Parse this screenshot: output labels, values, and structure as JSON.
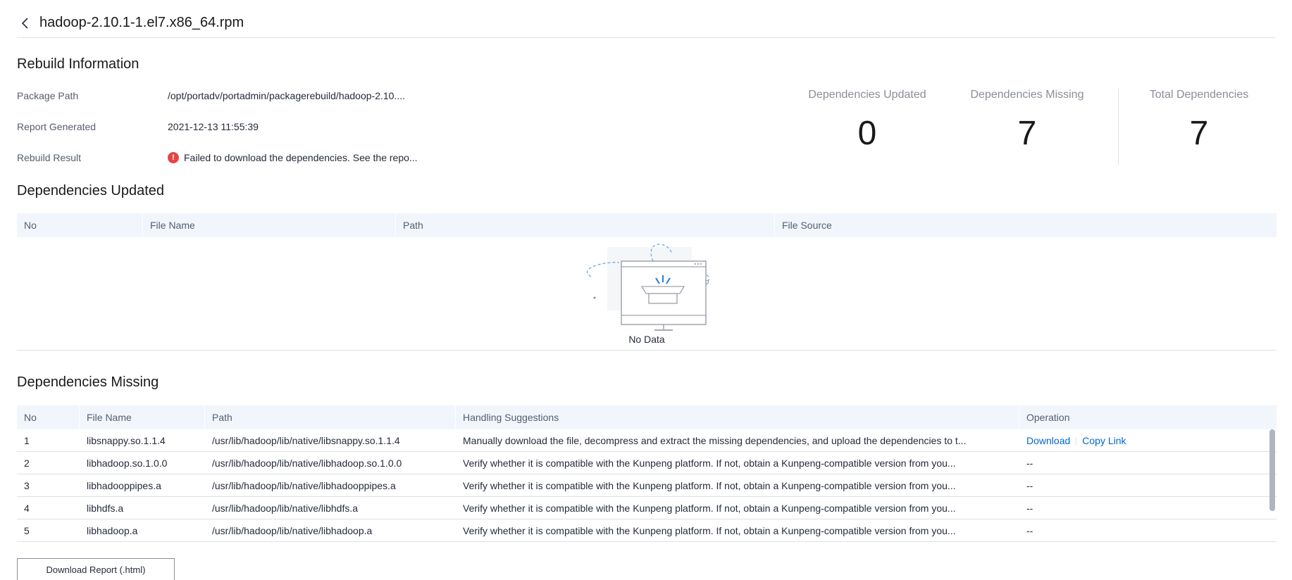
{
  "header": {
    "title": "hadoop-2.10.1-1.el7.x86_64.rpm"
  },
  "rebuild_info": {
    "title": "Rebuild Information",
    "rows": [
      {
        "label": "Package Path",
        "value": "/opt/portadv/portadmin/packagerebuild/hadoop-2.10...."
      },
      {
        "label": "Report Generated",
        "value": "2021-12-13 11:55:39"
      },
      {
        "label": "Rebuild Result",
        "value": "Failed to download the dependencies. See the repo..."
      }
    ],
    "result_status": "error",
    "error_color": "#e54545"
  },
  "stats": [
    {
      "label": "Dependencies Updated",
      "value": "0"
    },
    {
      "label": "Dependencies Missing",
      "value": "7"
    },
    {
      "label": "Total Dependencies",
      "value": "7"
    }
  ],
  "updated": {
    "title": "Dependencies Updated",
    "columns": [
      "No",
      "File Name",
      "Path",
      "File Source"
    ],
    "empty_text": "No Data"
  },
  "missing": {
    "title": "Dependencies Missing",
    "columns": [
      "No",
      "File Name",
      "Path",
      "Handling Suggestions",
      "Operation"
    ],
    "rows": [
      {
        "no": "1",
        "file": "libsnappy.so.1.1.4",
        "path": "/usr/lib/hadoop/lib/native/libsnappy.so.1.1.4",
        "suggestion": "Manually download the file, decompress and extract the missing dependencies, and upload the dependencies to t...",
        "op_download": "Download",
        "op_copy": "Copy Link"
      },
      {
        "no": "2",
        "file": "libhadoop.so.1.0.0",
        "path": "/usr/lib/hadoop/lib/native/libhadoop.so.1.0.0",
        "suggestion": "Verify whether it is compatible with the Kunpeng platform. If not, obtain a Kunpeng-compatible version from you...",
        "op": "--"
      },
      {
        "no": "3",
        "file": "libhadooppipes.a",
        "path": "/usr/lib/hadoop/lib/native/libhadooppipes.a",
        "suggestion": "Verify whether it is compatible with the Kunpeng platform. If not, obtain a Kunpeng-compatible version from you...",
        "op": "--"
      },
      {
        "no": "4",
        "file": "libhdfs.a",
        "path": "/usr/lib/hadoop/lib/native/libhdfs.a",
        "suggestion": "Verify whether it is compatible with the Kunpeng platform. If not, obtain a Kunpeng-compatible version from you...",
        "op": "--"
      },
      {
        "no": "5",
        "file": "libhadoop.a",
        "path": "/usr/lib/hadoop/lib/native/libhadoop.a",
        "suggestion": "Verify whether it is compatible with the Kunpeng platform. If not, obtain a Kunpeng-compatible version from you...",
        "op": "--"
      }
    ]
  },
  "footer": {
    "download_button": "Download Report (.html)"
  },
  "colors": {
    "accent": "#0067d1",
    "table_header_bg": "#f0f6fc",
    "divider": "#dfe1e6"
  }
}
